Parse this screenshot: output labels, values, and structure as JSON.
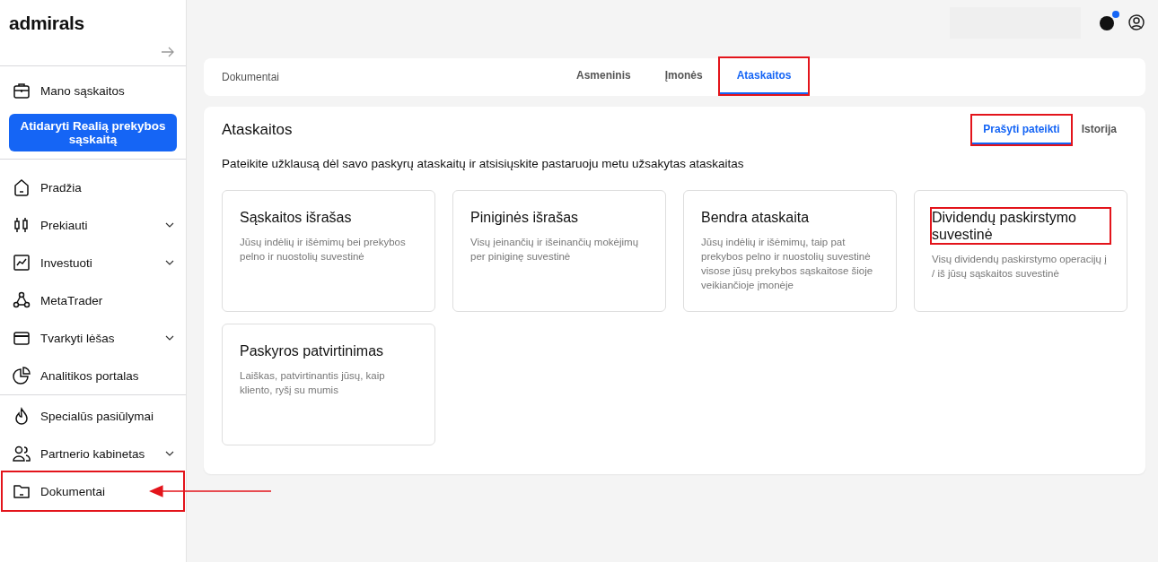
{
  "sidebar": {
    "logo": "admirals",
    "account_item": {
      "label": "Mano sąskaitos"
    },
    "open_account_button": "Atidaryti Realią prekybos sąskaitą",
    "nav_groups": [
      [
        {
          "label": "Pradžia",
          "expandable": false,
          "highlighted": false,
          "pointer_arrow": false
        },
        {
          "label": "Prekiauti",
          "expandable": true,
          "highlighted": false,
          "pointer_arrow": false
        },
        {
          "label": "Investuoti",
          "expandable": true,
          "highlighted": false,
          "pointer_arrow": false
        },
        {
          "label": "MetaTrader",
          "expandable": false,
          "highlighted": false,
          "pointer_arrow": false
        },
        {
          "label": "Tvarkyti lėšas",
          "expandable": true,
          "highlighted": false,
          "pointer_arrow": false
        },
        {
          "label": "Analitikos portalas",
          "expandable": false,
          "highlighted": false,
          "pointer_arrow": false
        }
      ],
      [
        {
          "label": "Specialūs pasiūlymai",
          "expandable": false,
          "highlighted": false,
          "pointer_arrow": false
        },
        {
          "label": "Partnerio kabinetas",
          "expandable": true,
          "highlighted": false,
          "pointer_arrow": false
        },
        {
          "label": "Dokumentai",
          "expandable": false,
          "highlighted": true,
          "pointer_arrow": true
        }
      ]
    ]
  },
  "topbar": {
    "notification_dot": true
  },
  "documents_header": {
    "title": "Dokumentai",
    "tabs": [
      {
        "label": "Asmeninis",
        "selected": false,
        "highlighted": false
      },
      {
        "label": "Įmonės",
        "selected": false,
        "highlighted": false
      },
      {
        "label": "Ataskaitos",
        "selected": true,
        "highlighted": true
      }
    ]
  },
  "reports": {
    "title": "Ataskaitos",
    "tabs": [
      {
        "label": "Prašyti pateikti",
        "selected": true,
        "highlighted": true
      },
      {
        "label": "Istorija",
        "selected": false,
        "highlighted": false
      }
    ],
    "description": "Pateikite užklausą dėl savo paskyrų ataskaitų ir atsisiųskite pastaruoju metu užsakytas ataskaitas",
    "cards": [
      {
        "title": "Sąskaitos išrašas",
        "description": "Jūsų indėlių ir išėmimų bei prekybos pelno ir nuostolių suvestinė",
        "highlighted": false
      },
      {
        "title": "Piniginės išrašas",
        "description": "Visų įeinančių ir išeinančių mokėjimų per piniginę suvestinė",
        "highlighted": false
      },
      {
        "title": "Bendra ataskaita",
        "description": "Jūsų indėlių ir išėmimų, taip pat prekybos pelno ir nuostolių suvestinė visose jūsų prekybos sąskaitose šioje veikiančioje įmonėje",
        "highlighted": false
      },
      {
        "title": "Dividendų paskirstymo suvestinė",
        "description": "Visų dividendų paskirstymo operacijų į / iš jūsų sąskaitos suvestinė",
        "highlighted": true
      },
      {
        "title": "Paskyros patvirtinimas",
        "description": "Laiškas, patvirtinantis jūsų, kaip kliento, ryšį su mumis",
        "highlighted": false
      }
    ]
  }
}
